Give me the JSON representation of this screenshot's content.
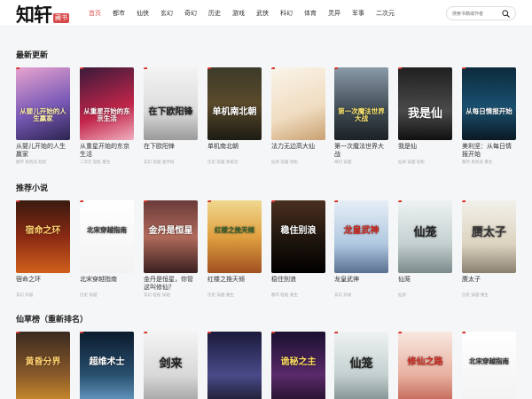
{
  "header": {
    "logo_main": "知轩",
    "logo_seal": "藏书",
    "nav": [
      "首页",
      "都市",
      "仙侠",
      "玄幻",
      "奇幻",
      "历史",
      "游戏",
      "武侠",
      "科幻",
      "体育",
      "灵异",
      "军事",
      "二次元"
    ],
    "active_nav": "首页",
    "search_placeholder": "搜索书籍或作者"
  },
  "colors": {
    "accent": "#e25a5a",
    "background": "#f5f6f8"
  },
  "sections": [
    {
      "title": "最新更新",
      "books": [
        {
          "title": "从婴儿开始的人生赢家",
          "meta": "都市 系统流 轻松",
          "cover_text": "从婴儿开始的人生赢家",
          "bg": "linear-gradient(160deg,#e8a4cf,#7a5ab8 55%,#2b2450)",
          "fg": "#fff2a8"
        },
        {
          "title": "从重星开始的东京生活",
          "meta": "二次元 轻松 重生",
          "cover_text": "从重星开始的东京生活",
          "bg": "linear-gradient(160deg,#3a1a3a,#c2254a 60%,#f0b0c0)",
          "fg": "#ffffff"
        },
        {
          "title": "在下欧阳锋",
          "meta": "玄幻 穿越 金手指",
          "cover_text": "在下欧阳锋",
          "bg": "linear-gradient(180deg,#f3f3f3,#dcdcdc 60%,#9a9a9a)",
          "fg": "#222222"
        },
        {
          "title": "单机南北朝",
          "meta": "历史 穿越 系统流",
          "cover_text": "单机南北朝",
          "bg": "linear-gradient(180deg,#3c3a2a,#5a4a2a 50%,#1d1b14)",
          "fg": "#ffffff"
        },
        {
          "title": "法力无边高大仙",
          "meta": "仙侠 穿越 轻松",
          "cover_text": "",
          "bg": "linear-gradient(160deg,#faf4ea,#f0dcc0 60%,#c8a070)",
          "fg": "#d85a30"
        },
        {
          "title": "第一次魔法世界大战",
          "meta": "奇幻 穿越",
          "cover_text": "第一次魔法世界大战",
          "bg": "linear-gradient(180deg,#8a9aa8,#3e4a52 60%,#1c2226)",
          "fg": "#ffe870"
        },
        {
          "title": "我是仙",
          "meta": "仙侠 穿越 轻松",
          "cover_text": "我是仙",
          "bg": "linear-gradient(180deg,#202020,#4a4a4a 60%,#101010)",
          "fg": "#ffffff"
        },
        {
          "title": "美利坚：从每日情报开始",
          "meta": "都市 系统流 重生",
          "cover_text": "从每日情报开始",
          "bg": "linear-gradient(180deg,#0c2a3c,#1a5070 55%,#0a1a24)",
          "fg": "#ffffff"
        }
      ]
    },
    {
      "title": "推荐小说",
      "books": [
        {
          "title": "宿命之环",
          "meta": "玄幻 升级",
          "cover_text": "宿命之环",
          "bg": "linear-gradient(180deg,#3a1a10,#8a2a14 50%,#d0601c)",
          "fg": "#ffd070"
        },
        {
          "title": "北宋穿越指南",
          "meta": "历史 穿越",
          "cover_text": "北宋穿越指南",
          "bg": "linear-gradient(180deg,#ffffff,#f2f2f2)",
          "fg": "#333333"
        },
        {
          "title": "金丹是恒星，你管这叫修仙？",
          "meta": "玄幻 轻松 穿越",
          "cover_text": "金丹是恒星",
          "bg": "linear-gradient(180deg,#6a3a3a,#b06a5a 50%,#3a2020)",
          "fg": "#ffffff"
        },
        {
          "title": "红楼之挽天倾",
          "meta": "历史 穿越 重生",
          "cover_text": "红楼之挽天倾",
          "bg": "linear-gradient(180deg,#f0d890,#e0a040 50%,#a05020)",
          "fg": "#2a5a2a"
        },
        {
          "title": "稳住别浪",
          "meta": "都市 轻松 重生",
          "cover_text": "稳住别浪",
          "bg": "linear-gradient(180deg,#4a3020,#1a120c 60%,#000000)",
          "fg": "#ffffff"
        },
        {
          "title": "龙皇武神",
          "meta": "玄幻 升级",
          "cover_text": "龙皇武神",
          "bg": "linear-gradient(180deg,#e6eef6,#b0c8e0 60%,#5a7090)",
          "fg": "#c8231a"
        },
        {
          "title": "仙笼",
          "meta": "仙侠",
          "cover_text": "仙笼",
          "bg": "linear-gradient(180deg,#eef2f2,#c4d0d0 60%,#7a8a8a)",
          "fg": "#222222"
        },
        {
          "title": "赝太子",
          "meta": "历史 穿越 重生",
          "cover_text": "赝太子",
          "bg": "linear-gradient(180deg,#f2f0ea,#dcd4c0 60%,#8a8070)",
          "fg": "#333333"
        }
      ]
    },
    {
      "title": "仙草榜（重新排名）",
      "books": [
        {
          "title": "",
          "meta": "",
          "cover_text": "黄昏分界",
          "bg": "linear-gradient(180deg,#3a2a20,#8a5a2a 60%,#d0902c)",
          "fg": "#ffd070"
        },
        {
          "title": "",
          "meta": "",
          "cover_text": "超维术士",
          "bg": "linear-gradient(180deg,#0a1a2c,#2a5070 60%,#6aa0c8)",
          "fg": "#ffffff"
        },
        {
          "title": "",
          "meta": "",
          "cover_text": "剑来",
          "bg": "linear-gradient(180deg,#f4f4f4,#d8d8d8 60%,#a0a0a0)",
          "fg": "#222222"
        },
        {
          "title": "",
          "meta": "",
          "cover_text": "",
          "bg": "linear-gradient(180deg,#1a1a3a,#4a4a8a 60%,#1a1a2a)",
          "fg": "#ffffff"
        },
        {
          "title": "",
          "meta": "",
          "cover_text": "诡秘之主",
          "bg": "linear-gradient(180deg,#1a1030,#5a2a6a 60%,#201028)",
          "fg": "#ffe060"
        },
        {
          "title": "",
          "meta": "",
          "cover_text": "仙笼",
          "bg": "linear-gradient(180deg,#eef2f2,#c4d0d0 60%,#7a8a8a)",
          "fg": "#222222"
        },
        {
          "title": "",
          "meta": "",
          "cover_text": "修仙之路",
          "bg": "linear-gradient(180deg,#f8e8e0,#e8b0a0 60%,#c06050)",
          "fg": "#d02a20"
        },
        {
          "title": "",
          "meta": "",
          "cover_text": "北宋穿越指南",
          "bg": "linear-gradient(180deg,#ffffff,#f2f2f2)",
          "fg": "#333333"
        }
      ]
    }
  ]
}
